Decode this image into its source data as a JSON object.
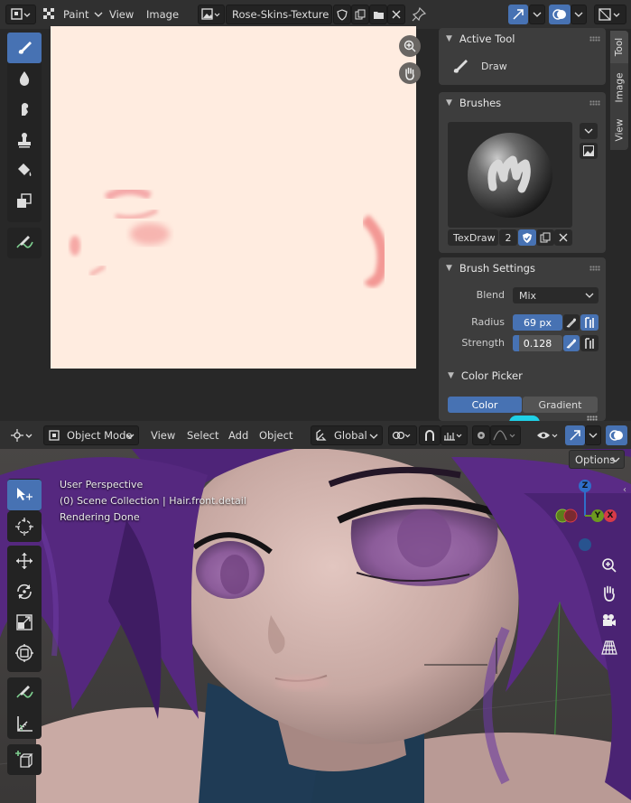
{
  "image_editor": {
    "header": {
      "editor_type_icon": "image-editor-icon",
      "mode_label": "Paint",
      "menus": [
        "View",
        "Image"
      ],
      "image_name": "Rose-Skins-Texture"
    },
    "tools": [
      {
        "name": "draw-brush-tool",
        "icon": "brush-icon",
        "active": true
      },
      {
        "name": "soften-tool",
        "icon": "drop-icon",
        "active": false
      },
      {
        "name": "smear-tool",
        "icon": "finger-icon",
        "active": false
      },
      {
        "name": "clone-tool",
        "icon": "stamp-icon",
        "active": false
      },
      {
        "name": "fill-tool",
        "icon": "bucket-icon",
        "active": false
      },
      {
        "name": "mask-tool",
        "icon": "mask-icon",
        "active": false
      },
      {
        "name": "annotate-tool",
        "icon": "annotate-icon",
        "active": false
      }
    ],
    "sidebar_tabs": [
      "Tool",
      "Image",
      "View"
    ],
    "active_tool_panel": {
      "title": "Active Tool",
      "tool_label": "Draw"
    },
    "brushes_panel": {
      "title": "Brushes",
      "brush_name": "TexDraw",
      "user_count": "2"
    },
    "brush_settings": {
      "title": "Brush Settings",
      "blend_label": "Blend",
      "blend_value": "Mix",
      "radius_label": "Radius",
      "radius_value": "69 px",
      "strength_label": "Strength",
      "strength_value": "0.128",
      "strength_fraction": 0.128
    },
    "color_picker": {
      "title": "Color Picker",
      "tabs": [
        "Color",
        "Gradient"
      ],
      "active_tab": "Color"
    }
  },
  "viewport": {
    "header": {
      "mode_label": "Object Mode",
      "menus": [
        "View",
        "Select",
        "Add",
        "Object"
      ],
      "transform_orientation": "Global",
      "options_label": "Options"
    },
    "overlay_info": {
      "perspective": "User Perspective",
      "collection": "(0) Scene Collection | Hair.front.detail",
      "status": "Rendering Done"
    },
    "gizmo_axes": {
      "z": "Z",
      "y": "Y",
      "x": "X"
    },
    "tools": [
      {
        "name": "select-box-tool",
        "icon": "select-cursor-icon",
        "active": true
      },
      {
        "name": "cursor-tool",
        "icon": "crosshair-icon",
        "active": false
      },
      {
        "name": "move-tool",
        "icon": "move-icon",
        "active": false
      },
      {
        "name": "rotate-tool",
        "icon": "rotate-icon",
        "active": false
      },
      {
        "name": "scale-tool",
        "icon": "scale-icon",
        "active": false
      },
      {
        "name": "transform-tool",
        "icon": "transform-icon",
        "active": false
      },
      {
        "name": "annotate-tool",
        "icon": "annotate-icon",
        "active": false
      },
      {
        "name": "measure-tool",
        "icon": "ruler-icon",
        "active": false
      },
      {
        "name": "add-cube-tool",
        "icon": "add-cube-icon",
        "active": false
      }
    ],
    "nav_gizmos": [
      "zoom-icon",
      "hand-pan-icon",
      "camera-icon",
      "perspective-grid-icon"
    ]
  },
  "colors": {
    "accent": "#4772b3",
    "header_bg": "#303030",
    "panel_bg": "#3d3d3d",
    "texture_bg": "#ffece0",
    "hair": "#5b2a8c"
  }
}
